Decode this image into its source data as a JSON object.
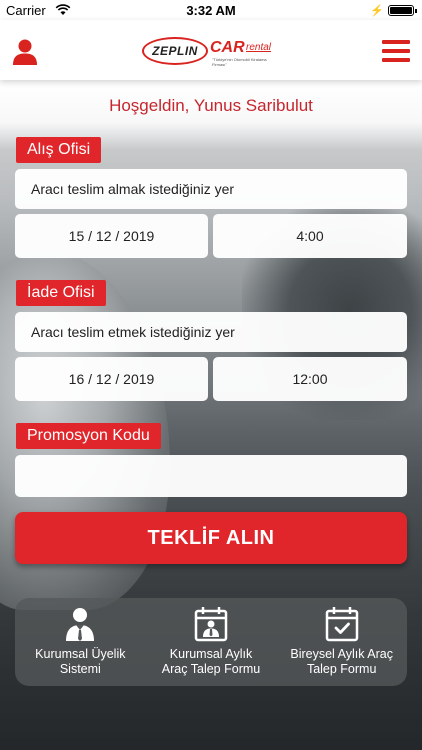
{
  "status_bar": {
    "carrier": "Carrier",
    "time": "3:32 AM"
  },
  "brand": {
    "zeplin": "ZEPLIN",
    "car": "CAR",
    "rental": "rental",
    "tagline": "\"Türkiye'nin Otomobil Kiralama Firması\"",
    "accent_color": "#e0252b"
  },
  "greeting": "Hoşgeldin, Yunus Saribulut",
  "pickup": {
    "label": "Alış Ofisi",
    "location_placeholder": "Aracı teslim almak istediğiniz yer",
    "date": "15 / 12 / 2019",
    "time": "4:00"
  },
  "dropoff": {
    "label": "İade Ofisi",
    "location_placeholder": "Aracı teslim etmek istediğiniz yer",
    "date": "16 / 12 / 2019",
    "time": "12:00"
  },
  "promo": {
    "label": "Promosyon Kodu",
    "value": ""
  },
  "cta_label": "TEKLİF ALIN",
  "quick_links": [
    {
      "icon": "business-user-icon",
      "label_line1": "Kurumsal Üyelik",
      "label_line2": "Sistemi"
    },
    {
      "icon": "calendar-person-icon",
      "label_line1": "Kurumsal Aylık",
      "label_line2": "Araç Talep Formu"
    },
    {
      "icon": "calendar-check-icon",
      "label_line1": "Bireysel Aylık Araç",
      "label_line2": "Talep Formu"
    }
  ]
}
